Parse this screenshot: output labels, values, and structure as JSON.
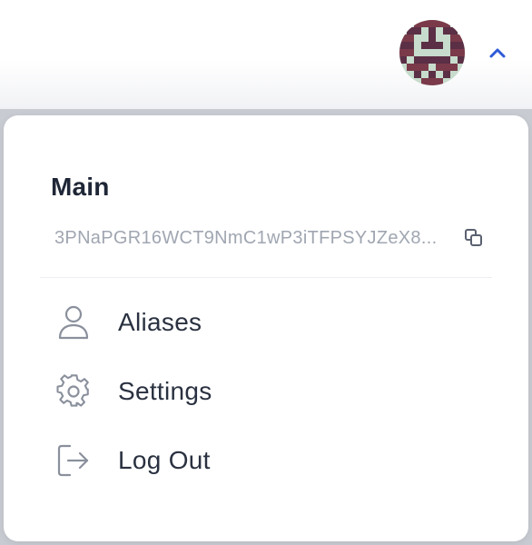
{
  "header": {
    "avatar_name": "avatar",
    "toggle_icon": "chevron-up-icon",
    "accent_color": "#2f5bd8"
  },
  "account_menu": {
    "account_name": "Main",
    "address": "3PNaPGR16WCT9NmC1wP3iTFPSYJZeX8...",
    "copy_icon": "copy-icon",
    "items": [
      {
        "label": "Aliases",
        "icon": "user-icon"
      },
      {
        "label": "Settings",
        "icon": "gear-icon"
      },
      {
        "label": "Log Out",
        "icon": "logout-icon"
      }
    ]
  }
}
